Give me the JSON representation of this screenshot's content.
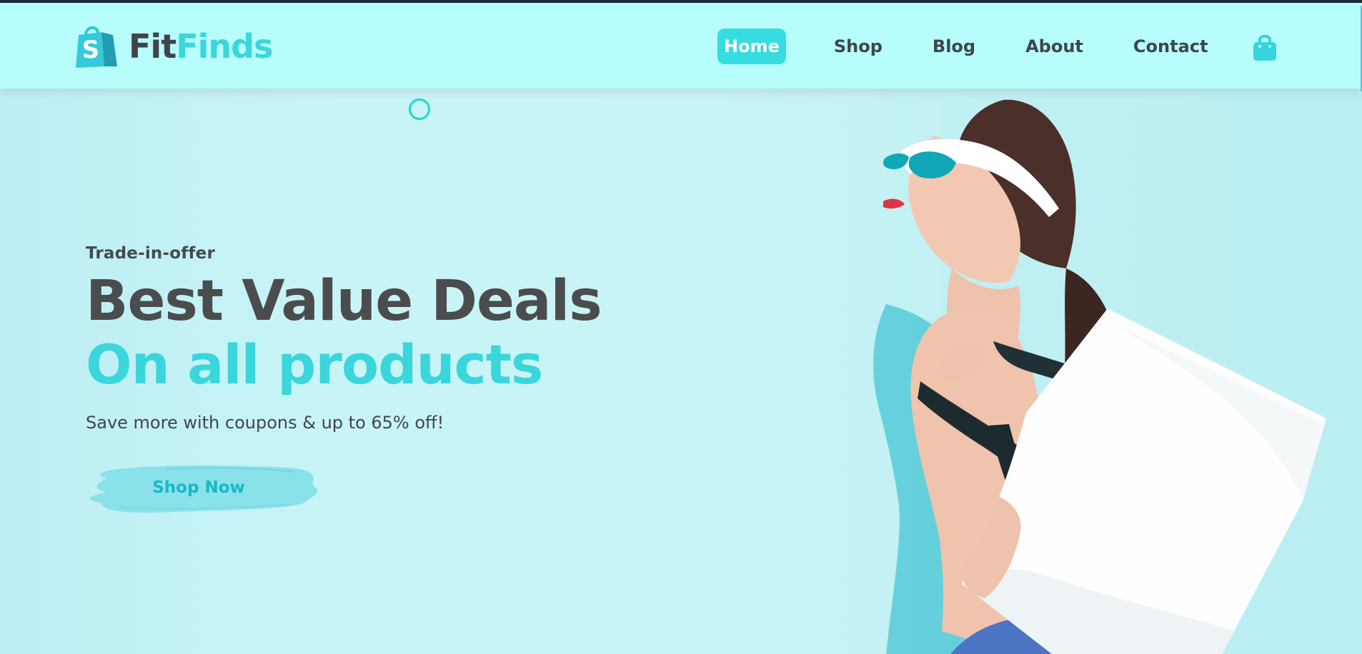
{
  "brand": {
    "name_part1": "Fit",
    "name_part2": "Finds",
    "logo_icon": "shopping-bag-icon",
    "logo_letter": "S"
  },
  "nav": {
    "items": [
      {
        "label": "Home",
        "active": true
      },
      {
        "label": "Shop",
        "active": false
      },
      {
        "label": "Blog",
        "active": false
      },
      {
        "label": "About",
        "active": false
      },
      {
        "label": "Contact",
        "active": false
      }
    ],
    "cart_icon": "shopping-bag-icon"
  },
  "hero": {
    "eyebrow": "Trade-in-offer",
    "title": "Best Value Deals",
    "subtitle": "On all products",
    "description": "Save more with coupons & up to 65% off!",
    "cta_label": "Shop Now"
  },
  "colors": {
    "accent": "#3ad6db",
    "header_bg": "#b6fdfc",
    "hero_bg": "#c8f4f7",
    "text_dark": "#4b4c4d",
    "cta_brush": "#89e2ea",
    "cta_text": "#1ab8c6"
  }
}
